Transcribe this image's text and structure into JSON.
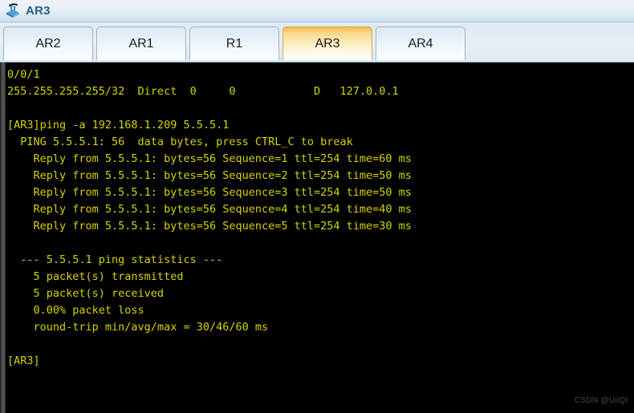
{
  "window": {
    "title": "AR3",
    "icon": "router-icon"
  },
  "tabs": [
    {
      "label": "AR2",
      "active": false
    },
    {
      "label": "AR1",
      "active": false
    },
    {
      "label": "R1",
      "active": false
    },
    {
      "label": "AR3",
      "active": true
    },
    {
      "label": "AR4",
      "active": false
    }
  ],
  "terminal": {
    "text_color": "#d4d400",
    "background_color": "#000000",
    "lines": [
      "0/0/1",
      "255.255.255.255/32  Direct  0     0            D   127.0.0.1",
      "",
      "[AR3]ping -a 192.168.1.209 5.5.5.1",
      "  PING 5.5.5.1: 56  data bytes, press CTRL_C to break",
      "    Reply from 5.5.5.1: bytes=56 Sequence=1 ttl=254 time=60 ms",
      "    Reply from 5.5.5.1: bytes=56 Sequence=2 ttl=254 time=50 ms",
      "    Reply from 5.5.5.1: bytes=56 Sequence=3 ttl=254 time=50 ms",
      "    Reply from 5.5.5.1: bytes=56 Sequence=4 ttl=254 time=40 ms",
      "    Reply from 5.5.5.1: bytes=56 Sequence=5 ttl=254 time=30 ms",
      "",
      "  --- 5.5.5.1 ping statistics ---",
      "    5 packet(s) transmitted",
      "    5 packet(s) received",
      "    0.00% packet loss",
      "    round-trip min/avg/max = 30/46/60 ms",
      "",
      "[AR3]"
    ]
  },
  "watermark": {
    "text": "CSDN @UiiQi"
  }
}
